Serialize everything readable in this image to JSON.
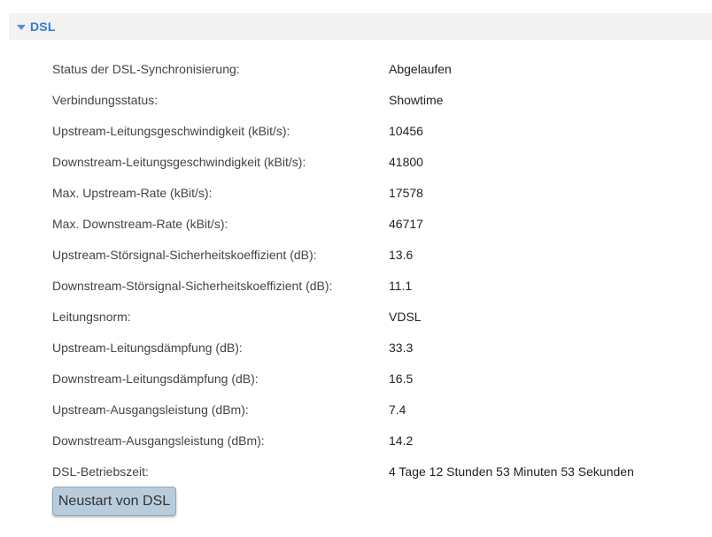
{
  "section": {
    "title": "DSL",
    "toggle_icon": "triangle-down-icon",
    "accent_color": "#2f7cd3"
  },
  "rows": [
    {
      "label": "Status der DSL-Synchronisierung:",
      "value": "Abgelaufen"
    },
    {
      "label": "Verbindungsstatus:",
      "value": "Showtime"
    },
    {
      "label": "Upstream-Leitungsgeschwindigkeit (kBit/s):",
      "value": "10456"
    },
    {
      "label": "Downstream-Leitungsgeschwindigkeit (kBit/s):",
      "value": "41800"
    },
    {
      "label": "Max. Upstream-Rate (kBit/s):",
      "value": "17578"
    },
    {
      "label": "Max. Downstream-Rate (kBit/s):",
      "value": "46717"
    },
    {
      "label": "Upstream-Störsignal-Sicherheitskoeffizient (dB):",
      "value": "13.6"
    },
    {
      "label": "Downstream-Störsignal-Sicherheitskoeffizient (dB):",
      "value": "11.1"
    },
    {
      "label": "Leitungsnorm:",
      "value": "VDSL"
    },
    {
      "label": "Upstream-Leitungsdämpfung (dB):",
      "value": "33.3"
    },
    {
      "label": "Downstream-Leitungsdämpfung (dB):",
      "value": "16.5"
    },
    {
      "label": "Upstream-Ausgangsleistung (dBm):",
      "value": "7.4"
    },
    {
      "label": "Downstream-Ausgangsleistung (dBm):",
      "value": "14.2"
    },
    {
      "label": "DSL-Betriebszeit:",
      "value": "4 Tage 12 Stunden 53 Minuten 53 Sekunden"
    }
  ],
  "restart_button": {
    "label": "Neustart von DSL"
  }
}
